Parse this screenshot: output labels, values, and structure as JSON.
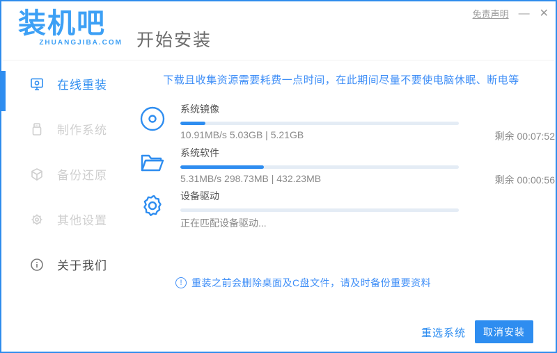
{
  "window": {
    "logo_text": "装机吧",
    "logo_sub": "ZHUANGJIBA.COM",
    "disclaimer_label": "免责声明",
    "minimize_glyph": "—",
    "close_glyph": "✕"
  },
  "header": {
    "title": "开始安装"
  },
  "sidebar": {
    "items": [
      {
        "label": "在线重装",
        "icon": "monitor-icon",
        "state": "active"
      },
      {
        "label": "制作系统",
        "icon": "usb-icon",
        "state": "inactive"
      },
      {
        "label": "备份还原",
        "icon": "backup-cube-icon",
        "state": "inactive"
      },
      {
        "label": "其他设置",
        "icon": "gear-icon",
        "state": "inactive"
      },
      {
        "label": "关于我们",
        "icon": "info-icon",
        "state": "dark"
      }
    ]
  },
  "main": {
    "warning": "下载且收集资源需要耗费一点时间，在此期间尽量不要使电脑休眠、断电等",
    "tasks": [
      {
        "name": "系统镜像",
        "icon": "disc-icon",
        "progress": "9%",
        "stats": "10.91MB/s 5.03GB | 5.21GB",
        "remaining": "剩余 00:07:52"
      },
      {
        "name": "系统软件",
        "icon": "folder-icon",
        "progress": "30%",
        "stats": "5.31MB/s 298.73MB | 432.23MB",
        "remaining": "剩余 00:00:56"
      },
      {
        "name": "设备驱动",
        "icon": "driver-gear-icon",
        "progress": "0%",
        "stats": "正在匹配设备驱动...",
        "remaining": ""
      }
    ],
    "notice_icon": "!",
    "notice": "重装之前会删除桌面及C盘文件，请及时备份重要资料"
  },
  "footer": {
    "reselect_label": "重选系统",
    "cancel_label": "取消安装"
  },
  "colors": {
    "accent": "#2e8df0",
    "logo_blue": "#3da0f5",
    "link_blue": "#3e8ef7",
    "track": "#e4ecf5",
    "inactive_gray": "#cfcfcf"
  }
}
